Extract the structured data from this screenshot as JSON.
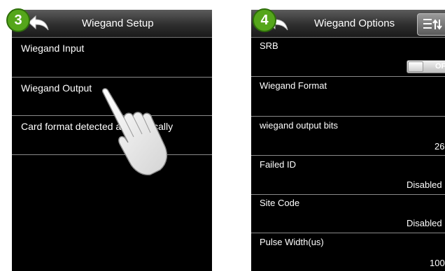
{
  "screen1": {
    "step": "3",
    "title": "Wiegand Setup",
    "items": [
      "Wiegand Input",
      "Wiegand Output",
      "Card format detected automatically"
    ]
  },
  "screen2": {
    "step": "4",
    "title": "Wiegand Options",
    "srb": {
      "label": "SRB",
      "toggle": "OFF"
    },
    "items": [
      {
        "label": "Wiegand Format",
        "value": ""
      },
      {
        "label": "wiegand output bits",
        "value": "26"
      },
      {
        "label": "Failed ID",
        "value": "Disabled"
      },
      {
        "label": "Site Code",
        "value": "Disabled"
      },
      {
        "label": "Pulse Width(us)",
        "value": "100"
      }
    ]
  },
  "colors": {
    "badge": "#55a61b",
    "screen_bg": "#000000",
    "divider": "#8a8a8a"
  },
  "icons": [
    "back-arrow-icon",
    "menu-sort-icon",
    "pointing-hand-icon"
  ]
}
